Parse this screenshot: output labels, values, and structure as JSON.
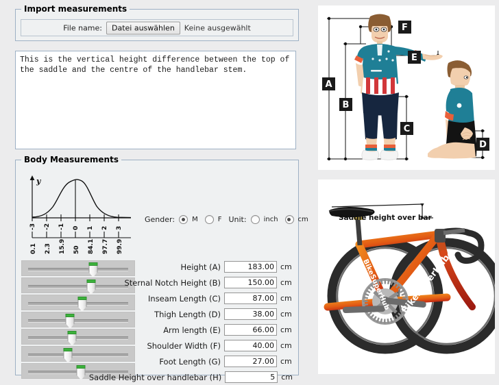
{
  "import": {
    "legend": "Import measurements",
    "file_label": "File name:",
    "choose_button": "Datei auswählen",
    "no_file": "Keine ausgewählt"
  },
  "description": {
    "text": "This is the vertical height difference between the top of the saddle and the centre of the handlebar stem."
  },
  "body": {
    "legend": "Body Measurements",
    "gender_label": "Gender:",
    "gender_options": [
      {
        "value": "M",
        "selected": true
      },
      {
        "value": "F",
        "selected": false
      }
    ],
    "unit_label": "Unit:",
    "unit_options": [
      {
        "value": "inch",
        "selected": false
      },
      {
        "value": "cm",
        "selected": true
      }
    ],
    "unit_selected": "cm"
  },
  "measurements": [
    {
      "label": "Height (A)",
      "value": "183.00",
      "unit": "cm",
      "slider_pct": 65
    },
    {
      "label": "Sternal Notch Height (B)",
      "value": "150.00",
      "unit": "cm",
      "slider_pct": 63
    },
    {
      "label": "Inseam Length (C)",
      "value": "87.00",
      "unit": "cm",
      "slider_pct": 54
    },
    {
      "label": "Thigh Length (D)",
      "value": "38.00",
      "unit": "cm",
      "slider_pct": 42
    },
    {
      "label": "Arm length (E)",
      "value": "66.00",
      "unit": "cm",
      "slider_pct": 44
    },
    {
      "label": "Shoulder Width (F)",
      "value": "40.00",
      "unit": "cm",
      "slider_pct": 40
    },
    {
      "label": "Foot Length (G)",
      "value": "27.00",
      "unit": "cm",
      "slider_pct": 53
    },
    {
      "label": "Saddle Height over handlebar (H)",
      "value": "5",
      "unit": "cm",
      "slider_pct": null
    }
  ],
  "chart_data": {
    "type": "line",
    "title": "",
    "xlabel": "",
    "ylabel": "y",
    "x": [
      -3,
      -2,
      -1,
      0,
      1,
      2,
      3
    ],
    "xtick_labels": [
      "-3",
      "-2",
      "-1",
      "0",
      "1",
      "2",
      "3"
    ],
    "percentile_labels": [
      "0.1",
      "2.3",
      "15.9",
      "50",
      "84.1",
      "97.7",
      "99.9"
    ],
    "percentile_values": [
      0.1,
      2.3,
      15.9,
      50,
      84.1,
      97.7,
      99.9
    ],
    "values": [
      0.004,
      0.054,
      0.242,
      0.399,
      0.242,
      0.054,
      0.004
    ],
    "xlim": [
      -3.2,
      3.2
    ],
    "ylim": [
      0,
      0.42
    ],
    "grid": false,
    "legend": false,
    "curve": "normal distribution"
  },
  "figures": {
    "body_diagram": {
      "name": "cyclist-body-measurement-diagram",
      "labels": [
        "A",
        "B",
        "C",
        "D",
        "E",
        "F"
      ]
    },
    "bike_diagram": {
      "name": "bicycle-saddle-height-diagram",
      "annotation": "Saddle height over bar",
      "brand": "BikeSuperHub"
    }
  },
  "colors": {
    "accent_green": "#3cb23c",
    "panel_border": "#9db0c4",
    "jersey_teal": "#1f7f96",
    "frame_orange": "#e8731a",
    "frame_red": "#c0281b"
  }
}
